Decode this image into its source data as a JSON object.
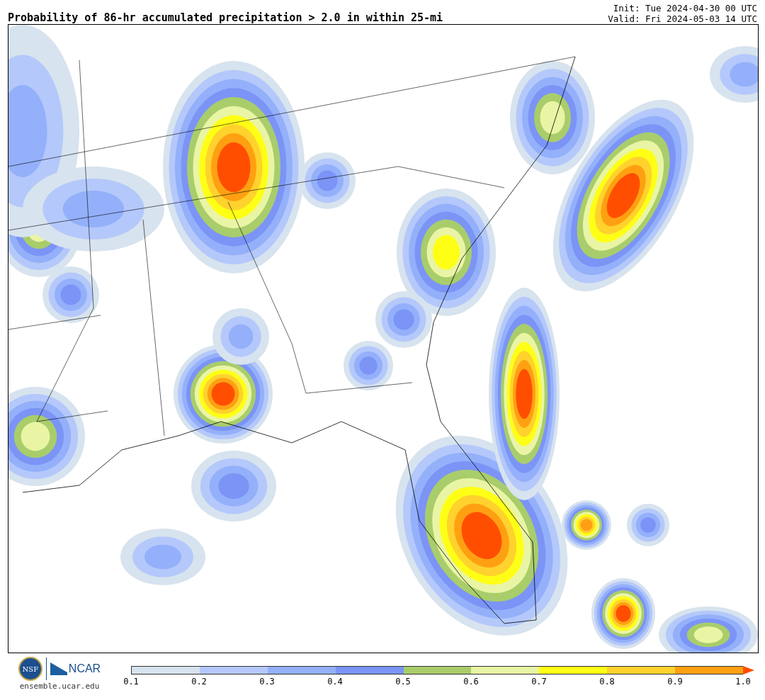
{
  "title": "Probability of 86-hr accumulated precipitation > 2.0 in within 25-mi",
  "init": "Init: Tue 2024-04-30 00 UTC",
  "valid": "Valid: Fri 2024-05-03 14 UTC",
  "logo": {
    "seal_text": "NSF",
    "wordmark": "NCAR",
    "site": "ensemble.ucar.edu"
  },
  "colorbar": {
    "segments": [
      {
        "color": "#d7e3ee"
      },
      {
        "color": "#b4c8fb"
      },
      {
        "color": "#94b0fa"
      },
      {
        "color": "#7b94f6"
      },
      {
        "color": "#a9cd6b"
      },
      {
        "color": "#e9f5a5"
      },
      {
        "color": "#ffff16"
      },
      {
        "color": "#ffd22d"
      },
      {
        "color": "#ffa012"
      }
    ],
    "extend_arrow": {
      "color": "#ff4e00"
    },
    "ticks": [
      "0.1",
      "0.2",
      "0.3",
      "0.4",
      "0.5",
      "0.6",
      "0.7",
      "0.8",
      "0.9",
      "1.0"
    ]
  }
}
